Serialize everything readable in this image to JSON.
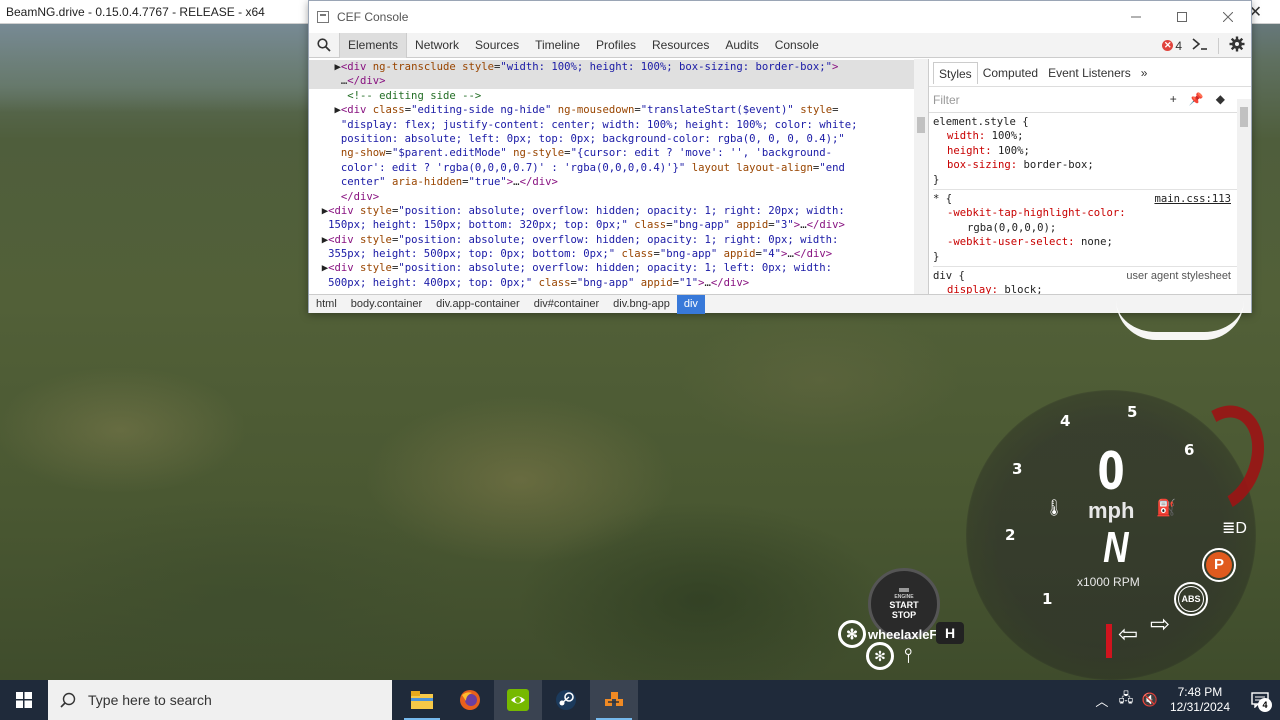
{
  "game_window": {
    "title": "BeamNG.drive - 0.15.0.4.7767 - RELEASE - x64",
    "close_glyph": "✕"
  },
  "cef": {
    "title": "CEF Console",
    "tabs": [
      "Elements",
      "Network",
      "Sources",
      "Timeline",
      "Profiles",
      "Resources",
      "Audits",
      "Console"
    ],
    "active_tab": "Elements",
    "error_count": "4",
    "dom_lines": [
      {
        "html": "    ▶<span class=\"tag\">&lt;div</span> <span class=\"attr\">ng-transclude</span> <span class=\"attr\">style</span>=<span class=\"val\">\"width: 100%; height: 100%; box-sizing: border-box;\"</span><span class=\"tag\">&gt;</span>",
        "sel": true
      },
      {
        "html": "     …<span class=\"tag\">&lt;/div&gt;</span>",
        "sel": true
      },
      {
        "html": "      <span class=\"cmt\">&lt;!-- editing side --&gt;</span>",
        "sel": false
      },
      {
        "html": "    ▶<span class=\"tag\">&lt;div</span> <span class=\"attr\">class</span>=<span class=\"val\">\"editing-side ng-hide\"</span> <span class=\"attr\">ng-mousedown</span>=<span class=\"val\">\"translateStart($event)\"</span> <span class=\"attr\">style</span>=",
        "sel": false
      },
      {
        "html": "     <span class=\"val\">\"display: flex; justify-content: center; width: 100%; height: 100%; color: white;</span>",
        "sel": false
      },
      {
        "html": "     <span class=\"val\">position: absolute; left: 0px; top: 0px; background-color: rgba(0, 0, 0, 0.4);\"</span>",
        "sel": false
      },
      {
        "html": "     <span class=\"attr\">ng-show</span>=<span class=\"val\">\"$parent.editMode\"</span> <span class=\"attr\">ng-style</span>=<span class=\"val\">\"{cursor: edit ? 'move': '', 'background-</span>",
        "sel": false
      },
      {
        "html": "     <span class=\"val\">color': edit ? 'rgba(0,0,0,0.7)' : 'rgba(0,0,0,0.4)'}\"</span> <span class=\"attr\">layout</span> <span class=\"attr\">layout-align</span>=<span class=\"val\">\"end</span>",
        "sel": false
      },
      {
        "html": "     <span class=\"val\">center\"</span> <span class=\"attr\">aria-hidden</span>=<span class=\"val\">\"true\"</span><span class=\"tag\">&gt;</span>…<span class=\"tag\">&lt;/div&gt;</span>",
        "sel": false
      },
      {
        "html": "     <span class=\"tag\">&lt;/div&gt;</span>",
        "sel": false
      },
      {
        "html": "  ▶<span class=\"tag\">&lt;div</span> <span class=\"attr\">style</span>=<span class=\"val\">\"position: absolute; overflow: hidden; opacity: 1; right: 20px; width:</span>",
        "sel": false
      },
      {
        "html": "   <span class=\"val\">150px; height: 150px; bottom: 320px; top: 0px;\"</span> <span class=\"attr\">class</span>=<span class=\"val\">\"bng-app\"</span> <span class=\"attr\">appid</span>=<span class=\"val\">\"3\"</span><span class=\"tag\">&gt;</span>…<span class=\"tag\">&lt;/div&gt;</span>",
        "sel": false
      },
      {
        "html": "  ▶<span class=\"tag\">&lt;div</span> <span class=\"attr\">style</span>=<span class=\"val\">\"position: absolute; overflow: hidden; opacity: 1; right: 0px; width:</span>",
        "sel": false
      },
      {
        "html": "   <span class=\"val\">355px; height: 500px; top: 0px; bottom: 0px;\"</span> <span class=\"attr\">class</span>=<span class=\"val\">\"bng-app\"</span> <span class=\"attr\">appid</span>=<span class=\"val\">\"4\"</span><span class=\"tag\">&gt;</span>…<span class=\"tag\">&lt;/div&gt;</span>",
        "sel": false
      },
      {
        "html": "  ▶<span class=\"tag\">&lt;div</span> <span class=\"attr\">style</span>=<span class=\"val\">\"position: absolute; overflow: hidden; opacity: 1; left: 0px; width:</span>",
        "sel": false
      },
      {
        "html": "   <span class=\"val\">500px; height: 400px; top: 0px;\"</span> <span class=\"attr\">class</span>=<span class=\"val\">\"bng-app\"</span> <span class=\"attr\">appid</span>=<span class=\"val\">\"1\"</span><span class=\"tag\">&gt;</span>…<span class=\"tag\">&lt;/div&gt;</span>",
        "sel": false
      }
    ],
    "styles_tabs": [
      "Styles",
      "Computed",
      "Event Listeners"
    ],
    "styles_more": "»",
    "filter_placeholder": "Filter",
    "rules": [
      {
        "selector": "element.style {",
        "source": "",
        "ua": "",
        "props": [
          [
            "width",
            "100%;"
          ],
          [
            "height",
            "100%;"
          ],
          [
            "box-sizing",
            "border-box;"
          ]
        ]
      },
      {
        "selector": "* {",
        "source": "main.css:113",
        "ua": "",
        "props": [
          [
            "-webkit-tap-highlight-color",
            ""
          ],
          [
            "",
            "rgba(0,0,0,0);"
          ],
          [
            "-webkit-user-select",
            "none;"
          ]
        ]
      },
      {
        "selector": "div {",
        "source": "",
        "ua": "user agent stylesheet",
        "props": [
          [
            "display",
            "block;"
          ]
        ]
      }
    ],
    "crumbs": [
      "html",
      "body.container",
      "div.app-container",
      "div#container",
      "div.bng-app",
      "div"
    ],
    "active_crumb": "div"
  },
  "hud": {
    "rpm_ticks": [
      "1",
      "2",
      "3",
      "4",
      "5",
      "6"
    ],
    "speed": "0",
    "unit": "mph",
    "gear": "N",
    "rpm_label": "x1000 RPM",
    "park": "P",
    "abs": "ABS",
    "start_stop": {
      "engine": "ENGINE",
      "line1": "START",
      "line2": "STOP"
    },
    "diff_label": "wheelaxleFl",
    "h_badge": "H"
  },
  "taskbar": {
    "search_placeholder": "Type here to search",
    "time": "7:48 PM",
    "date": "12/31/2024",
    "notification_count": "4",
    "apps": [
      "file-explorer-icon",
      "firefox-icon",
      "nvidia-icon",
      "steam-icon",
      "beamng-icon"
    ]
  },
  "colors": {
    "accent": "#3879d9",
    "error": "#e0433c",
    "park": "#e05a1e",
    "redline": "#9c1414",
    "taskbar": "#1f2a3a"
  }
}
